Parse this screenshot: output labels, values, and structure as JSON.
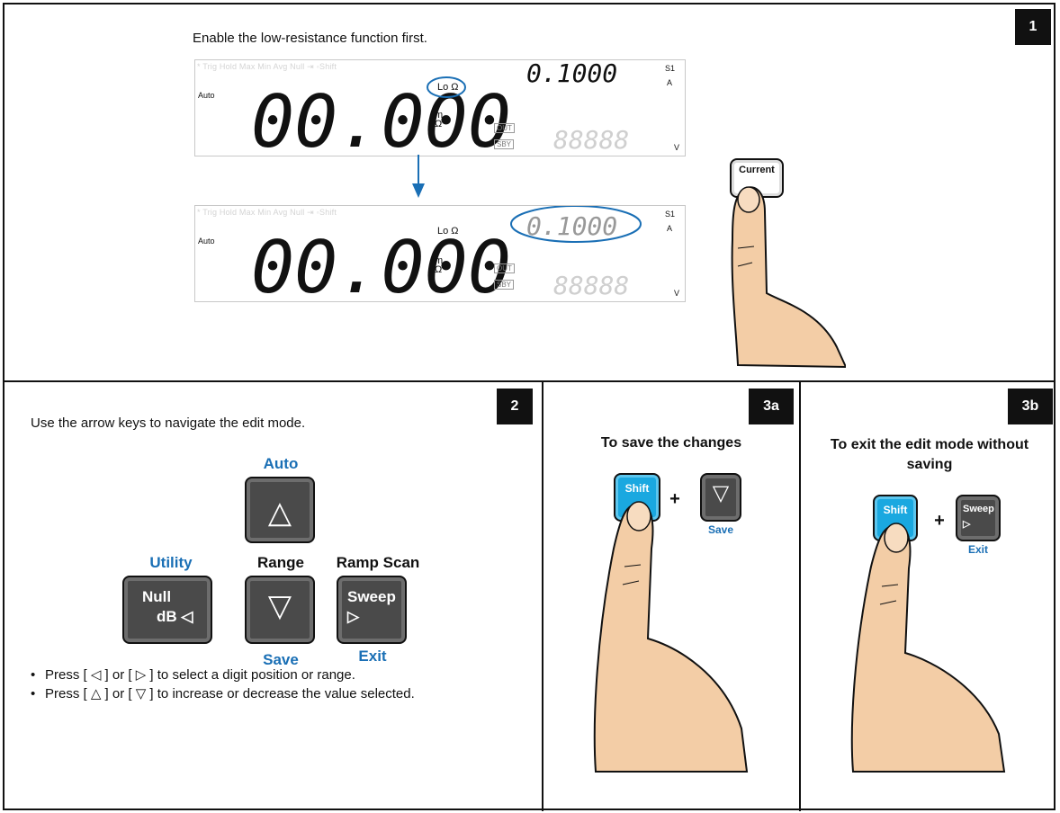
{
  "panel1": {
    "step": "1",
    "instruction": "Enable the low-resistance function first.",
    "lcd": {
      "auto": "Auto",
      "main_value": "00.000",
      "lo_ohm": "Lo Ω",
      "m_ohm": "m\nΩ",
      "top_right_value": "0.1000",
      "bottom_right_value": "88888",
      "s1": "S1",
      "a": "A",
      "v": "V",
      "out": "OUT",
      "sby": "SBY",
      "ghost_labels": "*   Trig   Hold   Max Min Avg   Null  ⇥  ◦Shift"
    },
    "key_label": "Current"
  },
  "panel2": {
    "step": "2",
    "instruction": "Use the arrow keys to navigate the edit mode.",
    "keys": {
      "auto": "Auto",
      "up_glyph": "△",
      "utility": "Utility",
      "range": "Range",
      "ramp_scan": "Ramp Scan",
      "null_line1": "Null",
      "null_line2": "dB ◁",
      "down_glyph": "▽",
      "sweep_line1": "Sweep",
      "sweep_line2": "▷",
      "save": "Save",
      "exit": "Exit"
    },
    "bullets": [
      "Press [ ◁ ] or [ ▷ ] to select a digit position or range.",
      "Press [ △ ] or [ ▽ ] to increase or decrease the value selected."
    ]
  },
  "panel3a": {
    "step": "3a",
    "heading": "To save the changes",
    "shift": "Shift",
    "plus": "+",
    "down_glyph": "▽",
    "save": "Save"
  },
  "panel3b": {
    "step": "3b",
    "heading": "To exit the edit mode without saving",
    "shift": "Shift",
    "plus": "+",
    "sweep": "Sweep",
    "sweep_glyph": "▷",
    "exit": "Exit"
  },
  "colors": {
    "accent_blue": "#1a6fb5",
    "shift_key": "#1aa8e0",
    "skin": "#f3cda6",
    "lcd_ellipse": "#1a6fb5"
  }
}
